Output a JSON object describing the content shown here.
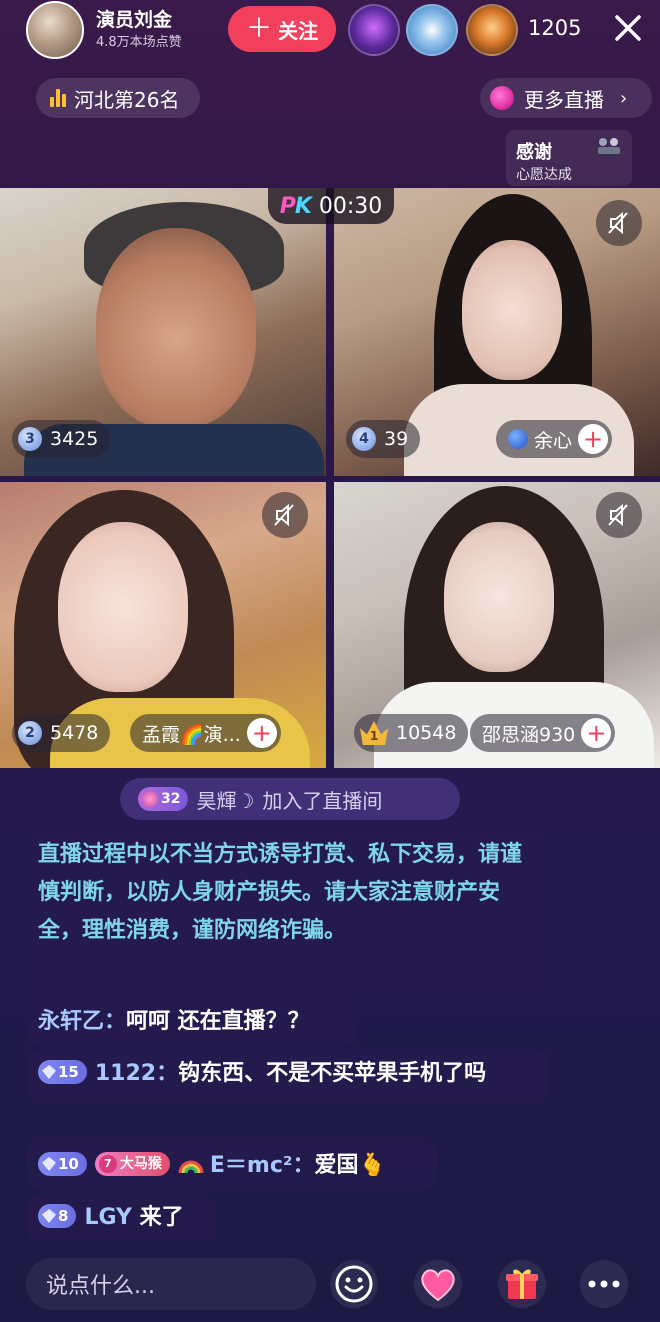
{
  "anchor": {
    "name": "演员刘金",
    "likes": "4.8万本场点赞"
  },
  "follow_label": "关注",
  "viewer_count": "1205",
  "rank_label": "河北第26名",
  "more_live_label": "更多直播",
  "thanks": {
    "title": "感谢",
    "subtitle": "心愿达成"
  },
  "pk": {
    "logo_p": "P",
    "logo_k": "K",
    "time": "00:30"
  },
  "players": [
    {
      "rank": "3",
      "score": "3425"
    },
    {
      "rank": "4",
      "score": "39",
      "name": "余心"
    },
    {
      "rank": "2",
      "score": "5478",
      "name": "孟霞🌈演..."
    },
    {
      "rank": "1",
      "score": "10548",
      "name": "邵思涵930"
    }
  ],
  "join": {
    "level": "32",
    "user": "昊輝☽",
    "text": "加入了直播间"
  },
  "notice": "直播过程中以不当方式诱导打赏、私下交易，请谨慎判断，以防人身财产损失。请大家注意财产安全，理性消费，谨防网络诈骗。",
  "chats": [
    {
      "user": "永轩乙：",
      "message": "呵呵 还在直播？？"
    },
    {
      "level": "15",
      "user": "1122：",
      "message": "钩东西、不是不买苹果手机了吗"
    },
    {
      "level": "10",
      "fan_level": "7",
      "fan_name": "大马猴",
      "user": "E＝mc²：",
      "message": "爱国🫰"
    },
    {
      "level": "8",
      "user": "LGY",
      "message": "来了"
    }
  ],
  "input_placeholder": "说点什么...",
  "colors": {
    "accent": "#f2405c",
    "notice": "#7fd6e6",
    "username": "#a9c8ff"
  }
}
